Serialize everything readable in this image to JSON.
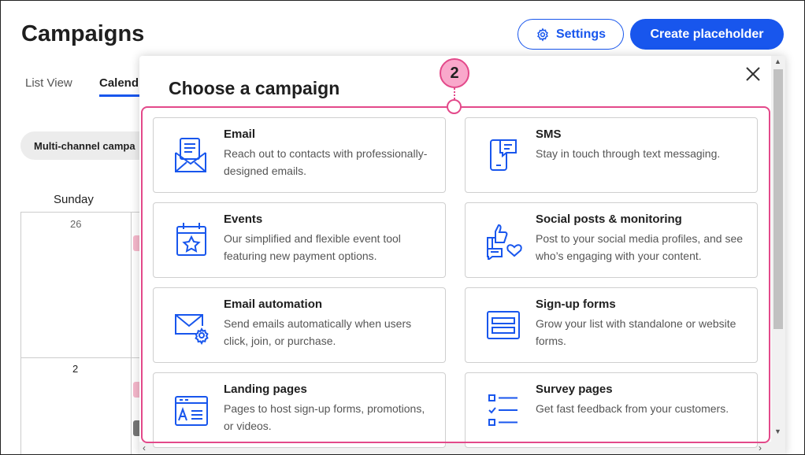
{
  "page": {
    "title": "Campaigns",
    "settings_label": "Settings",
    "create_label": "Create placeholder"
  },
  "tabs": {
    "list_view": "List View",
    "calendar": "Calend"
  },
  "filter": {
    "label": "Multi-channel campa"
  },
  "calendar": {
    "day_header": "Sunday",
    "dates": [
      "26",
      "2"
    ]
  },
  "modal": {
    "title": "Choose a campaign",
    "callout_number": "2",
    "cards": [
      {
        "title": "Email",
        "desc": "Reach out to contacts with professionally-designed emails.",
        "icon": "email-icon"
      },
      {
        "title": "SMS",
        "desc": "Stay in touch through text messaging.",
        "icon": "sms-icon"
      },
      {
        "title": "Events",
        "desc": "Our simplified and flexible event tool featuring new payment options.",
        "icon": "calendar-star-icon"
      },
      {
        "title": "Social posts & monitoring",
        "desc": "Post to your social media profiles, and see who’s engaging with your content.",
        "icon": "social-icon"
      },
      {
        "title": "Email automation",
        "desc": "Send emails automatically when users click, join, or purchase.",
        "icon": "email-gear-icon"
      },
      {
        "title": "Sign-up forms",
        "desc": "Grow your list with standalone or website forms.",
        "icon": "form-icon"
      },
      {
        "title": "Landing pages",
        "desc": "Pages to host sign-up forms, promotions, or videos.",
        "icon": "landing-page-icon"
      },
      {
        "title": "Survey pages",
        "desc": "Get fast feedback from your customers.",
        "icon": "survey-checklist-icon"
      }
    ]
  },
  "colors": {
    "brand_blue": "#1856ed",
    "highlight_pink": "#e3498a",
    "callout_fill": "#f9a8cb"
  }
}
